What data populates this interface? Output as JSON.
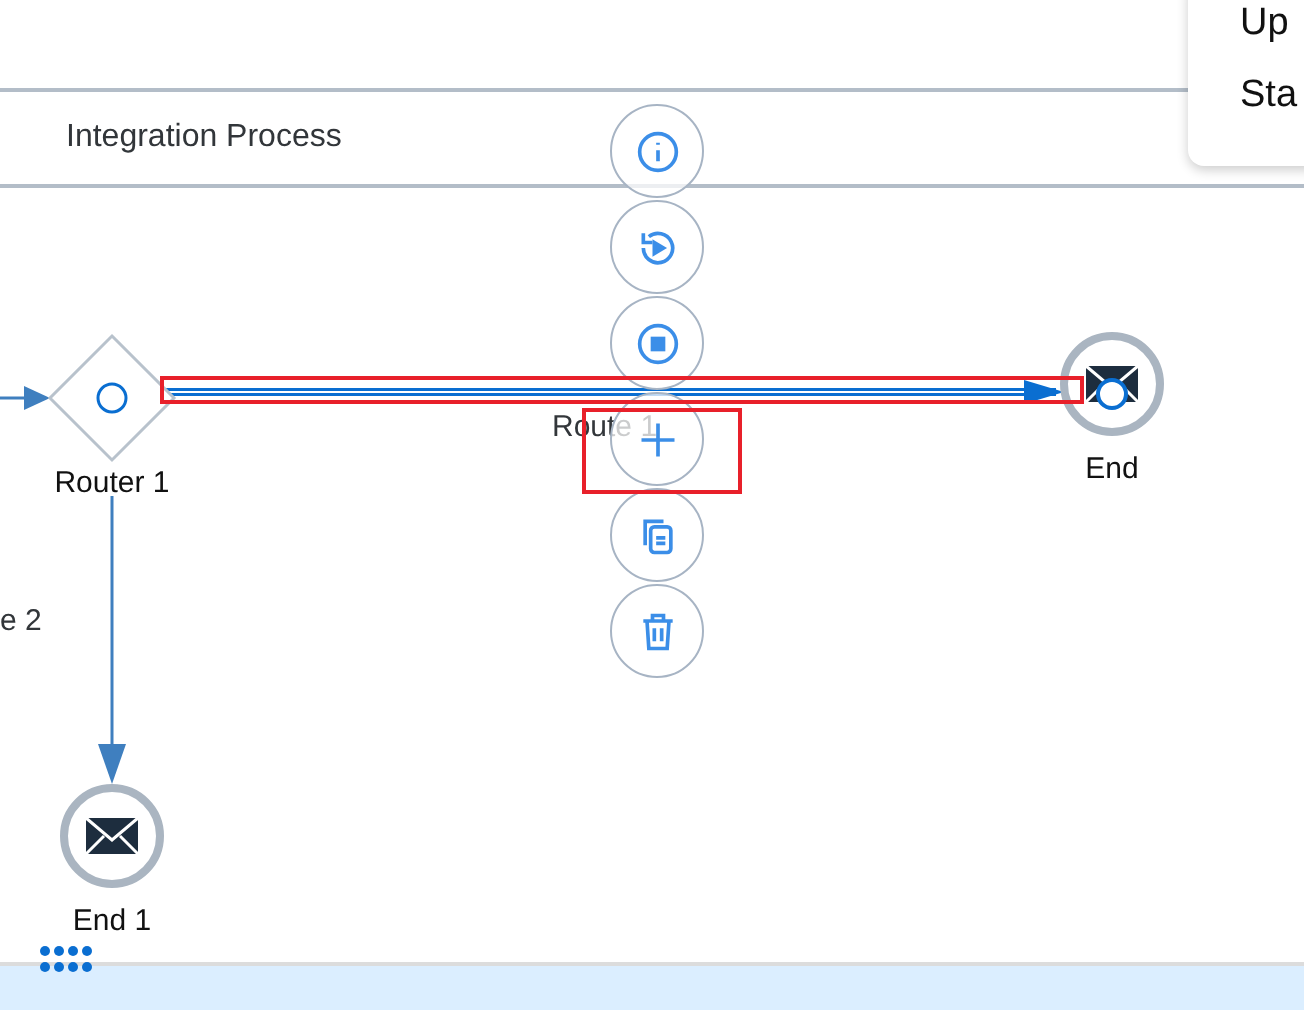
{
  "menu": {
    "items": [
      "Up",
      "Sta"
    ]
  },
  "lane": {
    "title": "Integration Process"
  },
  "nodes": [
    {
      "kind": "router",
      "label": "Router 1"
    },
    {
      "kind": "end",
      "label": "End"
    },
    {
      "kind": "end",
      "label": "End 1"
    }
  ],
  "edges": [
    {
      "label": "Route 1",
      "selected": true
    },
    {
      "label": "e 2",
      "selected": false
    }
  ]
}
